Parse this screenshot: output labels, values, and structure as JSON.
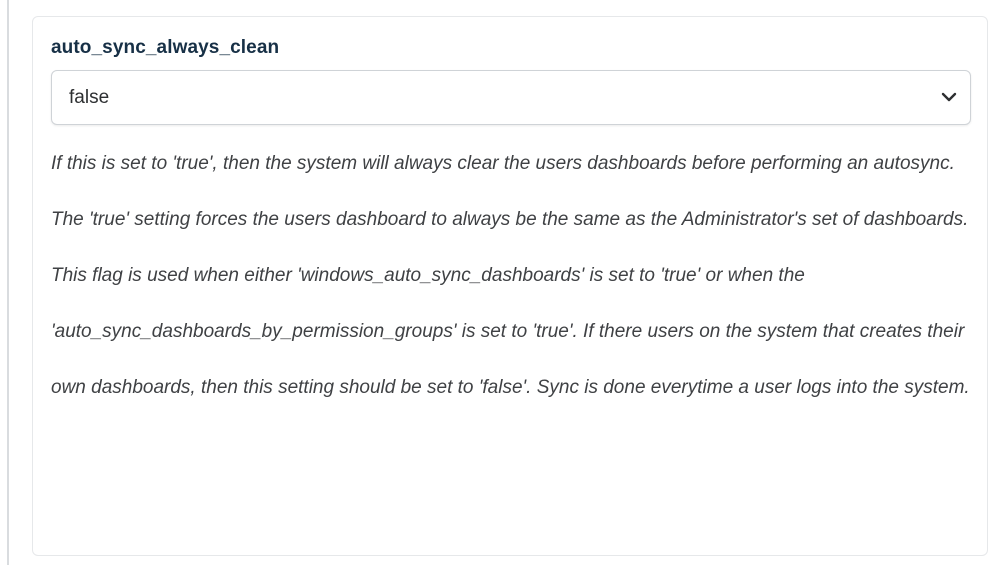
{
  "setting": {
    "name": "auto_sync_always_clean",
    "selected_value": "false",
    "description": "If this is set to 'true', then the system will always clear the users dashboards before performing an autosync. The 'true' setting forces the users dashboard to always be the same as the Administrator's set of dashboards. This flag is used when either 'windows_auto_sync_dashboards' is set to 'true' or when the 'auto_sync_dashboards_by_permission_groups' is set to 'true'. If there users on the system that creates their own dashboards, then this setting should be set to 'false'. Sync is done everytime a user logs into the system."
  },
  "icons": {
    "dropdown": "chevron-down-icon"
  }
}
